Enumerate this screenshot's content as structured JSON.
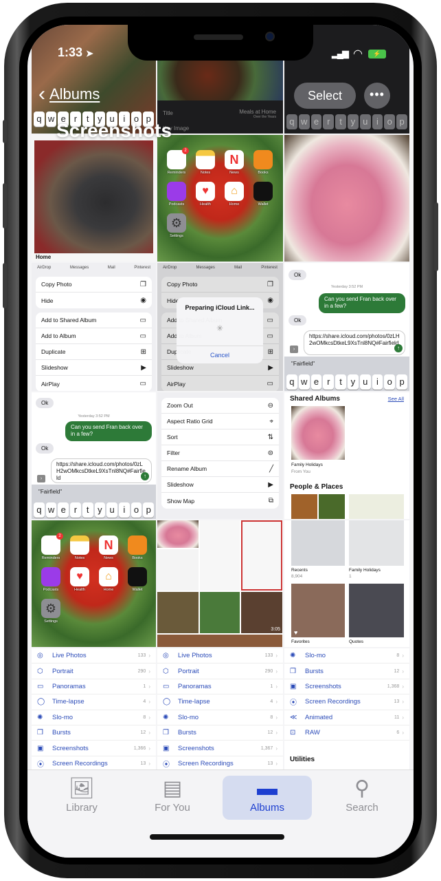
{
  "status_bar": {
    "time": "1:33",
    "location_icon": "location-arrow-icon",
    "signal": "signal-bars-icon",
    "wifi": "wifi-icon",
    "battery": "battery-charging-icon"
  },
  "nav": {
    "back_label": "Albums",
    "select_label": "Select",
    "more_label": "•••",
    "title": "Screenshots"
  },
  "keyboard_row": [
    "q",
    "w",
    "e",
    "r",
    "t",
    "y",
    "u",
    "i",
    "o",
    "p"
  ],
  "thumbs": {
    "home_label": "Home",
    "memory_title_label": "Title",
    "memory_title_value": "Meals at Home",
    "memory_subtitle": "Over the Years",
    "memory_image_label": "Key Image",
    "share_apps": [
      "AirDrop",
      "Messages",
      "Mail",
      "Pinterest"
    ],
    "share_menu_1": [
      "Copy Photo",
      "Hide"
    ],
    "share_menu_2": [
      "Add to Shared Album",
      "Add to Album",
      "Duplicate",
      "Slideshow",
      "AirPlay"
    ],
    "share_menu_icons_1": [
      "copy-icon",
      "eye-slash-icon"
    ],
    "share_menu_icons_2": [
      "shared-album-icon",
      "album-add-icon",
      "duplicate-icon",
      "slideshow-icon",
      "airplay-icon"
    ],
    "alert_title": "Preparing iCloud Link...",
    "alert_cancel": "Cancel",
    "messages": {
      "ok": "Ok",
      "timestamp": "Yesterday 3:52 PM",
      "outgoing": "Can you send Fran back over in a few?",
      "compose": "https://share.icloud.com/photos/0zLH2wOMkcsDtkeL9XsTnl8NQ#Fairfield",
      "suggestion": "\"Fairfield\""
    },
    "album_menu": [
      "Zoom Out",
      "Aspect Ratio Grid",
      "Sort",
      "Filter",
      "Rename Album",
      "Slideshow",
      "Show Map"
    ],
    "album_menu_icons": [
      "zoom-out-icon",
      "aspect-ratio-icon",
      "sort-icon",
      "filter-icon",
      "pencil-icon",
      "slideshow-icon",
      "map-icon"
    ],
    "home_apps": [
      {
        "label": "Reminders",
        "badge": "2"
      },
      {
        "label": "Notes"
      },
      {
        "label": "News"
      },
      {
        "label": "Books"
      },
      {
        "label": "Podcasts"
      },
      {
        "label": "Health"
      },
      {
        "label": "Home"
      },
      {
        "label": "Wallet"
      },
      {
        "label": "Settings"
      }
    ],
    "shared_albums": {
      "header": "Shared Albums",
      "see_all": "See All",
      "album_name": "Family Holidays",
      "album_sub": "From You",
      "people_header": "People & Places"
    },
    "albums_grid": [
      {
        "name": "Recents",
        "count": "8,904"
      },
      {
        "name": "Family Holidays",
        "count": "1"
      },
      {
        "name": "Favorites",
        "count": ""
      },
      {
        "name": "Quotes",
        "count": ""
      }
    ],
    "video_duration": "3:05",
    "media_types_a": [
      {
        "label": "Live Photos",
        "count": "133",
        "icon": "live-photos-icon"
      },
      {
        "label": "Portrait",
        "count": "290",
        "icon": "portrait-cube-icon"
      },
      {
        "label": "Panoramas",
        "count": "1",
        "icon": "panorama-icon"
      },
      {
        "label": "Time-lapse",
        "count": "4",
        "icon": "timelapse-icon"
      },
      {
        "label": "Slo-mo",
        "count": "8",
        "icon": "slomo-icon"
      },
      {
        "label": "Bursts",
        "count": "12",
        "icon": "bursts-icon"
      },
      {
        "label": "Screenshots",
        "count": "1,366",
        "icon": "screenshot-icon"
      },
      {
        "label": "Screen Recordings",
        "count": "13",
        "icon": "screen-recording-icon"
      }
    ],
    "media_types_b": [
      {
        "label": "Live Photos",
        "count": "133",
        "icon": "live-photos-icon"
      },
      {
        "label": "Portrait",
        "count": "290",
        "icon": "portrait-cube-icon"
      },
      {
        "label": "Panoramas",
        "count": "1",
        "icon": "panorama-icon"
      },
      {
        "label": "Time-lapse",
        "count": "4",
        "icon": "timelapse-icon"
      },
      {
        "label": "Slo-mo",
        "count": "8",
        "icon": "slomo-icon"
      },
      {
        "label": "Bursts",
        "count": "12",
        "icon": "bursts-icon"
      },
      {
        "label": "Screenshots",
        "count": "1,367",
        "icon": "screenshot-icon"
      },
      {
        "label": "Screen Recordings",
        "count": "13",
        "icon": "screen-recording-icon"
      }
    ],
    "media_types_c": [
      {
        "label": "Slo-mo",
        "count": "8",
        "icon": "slomo-icon"
      },
      {
        "label": "Bursts",
        "count": "12",
        "icon": "bursts-icon"
      },
      {
        "label": "Screenshots",
        "count": "1,368",
        "icon": "screenshot-icon"
      },
      {
        "label": "Screen Recordings",
        "count": "13",
        "icon": "screen-recording-icon"
      },
      {
        "label": "Animated",
        "count": "11",
        "icon": "animated-icon"
      },
      {
        "label": "RAW",
        "count": "6",
        "icon": "raw-icon"
      }
    ],
    "utilities_header": "Utilities"
  },
  "tabbar": {
    "tabs": [
      {
        "label": "Library",
        "icon": "library-photos-icon",
        "active": false
      },
      {
        "label": "For You",
        "icon": "for-you-icon",
        "active": false
      },
      {
        "label": "Albums",
        "icon": "albums-stack-icon",
        "active": true
      },
      {
        "label": "Search",
        "icon": "search-icon",
        "active": false
      }
    ]
  },
  "colors": {
    "accent": "#1d3fd0",
    "list_link": "#2b4bb8",
    "message_green": "#2d7a38",
    "tab_active_bg": "#d5dcf0"
  }
}
